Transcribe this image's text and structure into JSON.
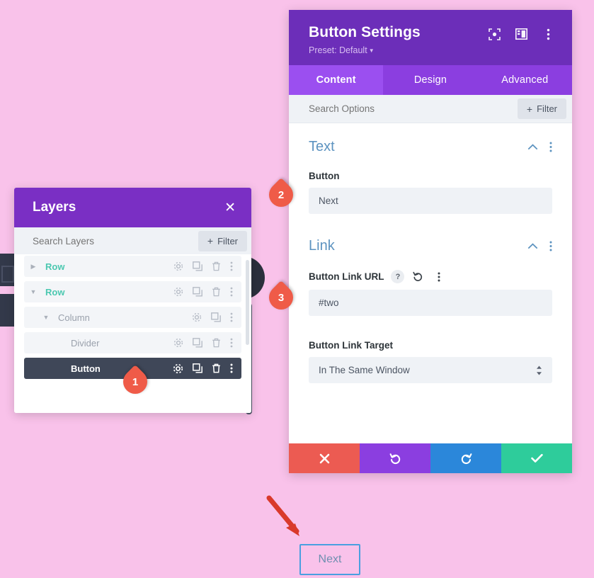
{
  "canvas": {
    "background_color": "#f9c2ea",
    "next_button": {
      "label": "Next",
      "border_color": "#4a9fe0",
      "text_color": "#6f8fb0"
    }
  },
  "markers": [
    {
      "number": "1",
      "color": "#ef5b48"
    },
    {
      "number": "2",
      "color": "#ef5b48"
    },
    {
      "number": "3",
      "color": "#ef5b48"
    }
  ],
  "button_settings": {
    "title": "Button Settings",
    "preset": "Preset: Default",
    "header_icons": [
      {
        "name": "focus-icon"
      },
      {
        "name": "layout-panel-icon"
      },
      {
        "name": "kebab-menu-icon"
      }
    ],
    "tabs": [
      {
        "label": "Content",
        "active": true
      },
      {
        "label": "Design",
        "active": false
      },
      {
        "label": "Advanced",
        "active": false
      }
    ],
    "search": {
      "placeholder": "Search Options",
      "value": "",
      "filter_label": "Filter"
    },
    "sections": [
      {
        "title": "Text",
        "collapsed": false,
        "fields": [
          {
            "label": "Button",
            "type": "text",
            "value": "Next",
            "icons": []
          }
        ]
      },
      {
        "title": "Link",
        "collapsed": false,
        "fields": [
          {
            "label": "Button Link URL",
            "type": "text",
            "value": "#two",
            "icons": [
              "help-icon",
              "reset-icon",
              "kebab-menu-icon"
            ]
          },
          {
            "label": "Button Link Target",
            "type": "select",
            "value": "In The Same Window",
            "icons": []
          }
        ]
      }
    ],
    "footer": {
      "cancel": {
        "name": "cancel-button",
        "color": "#ec5b52"
      },
      "undo": {
        "name": "undo-button",
        "color": "#8b3ee0"
      },
      "redo": {
        "name": "redo-button",
        "color": "#2b87da"
      },
      "save": {
        "name": "save-button",
        "color": "#2ecc9b"
      }
    },
    "colors": {
      "header_purple": "#6c2eb9",
      "tab_bar_purple": "#8b3ee0",
      "tab_active_purple": "#9b4ff0",
      "section_title_blue": "#5d93c0"
    }
  },
  "layers_panel": {
    "title": "Layers",
    "close_label": "✕",
    "search": {
      "placeholder": "Search Layers",
      "value": "",
      "filter_label": "Filter"
    },
    "rows": [
      {
        "name": "",
        "indent": 1,
        "clipped": true,
        "selected": false,
        "toggle": "",
        "style": "muted",
        "actions": [
          "gear",
          "duplicate",
          "trash",
          "kebab"
        ]
      },
      {
        "name": "Row",
        "indent": 0,
        "clipped": false,
        "selected": false,
        "toggle": "▶",
        "style": "teal",
        "actions": [
          "gear",
          "duplicate",
          "trash",
          "kebab"
        ]
      },
      {
        "name": "Row",
        "indent": 0,
        "clipped": false,
        "selected": false,
        "toggle": "▼",
        "style": "teal",
        "actions": [
          "gear",
          "duplicate",
          "trash",
          "kebab"
        ]
      },
      {
        "name": "Column",
        "indent": 1,
        "clipped": false,
        "selected": false,
        "toggle": "▼",
        "style": "muted",
        "actions": [
          "gear",
          "duplicate",
          "kebab"
        ]
      },
      {
        "name": "Divider",
        "indent": 2,
        "clipped": false,
        "selected": false,
        "toggle": "",
        "style": "muted",
        "actions": [
          "gear",
          "duplicate",
          "trash",
          "kebab"
        ]
      },
      {
        "name": "Button",
        "indent": 2,
        "clipped": false,
        "selected": true,
        "toggle": "",
        "style": "white",
        "actions": [
          "gear",
          "duplicate",
          "trash",
          "kebab"
        ]
      }
    ],
    "colors": {
      "header_purple": "#7a2fc4",
      "selected_row": "#3f4758",
      "layer_teal": "#4bc8b0"
    }
  }
}
